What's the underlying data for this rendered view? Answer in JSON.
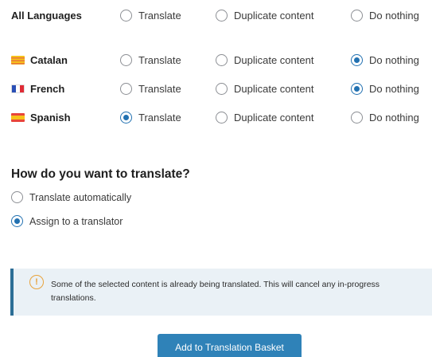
{
  "languages": [
    {
      "name": "All Languages",
      "flag": "",
      "selected": "none"
    },
    {
      "name": "Catalan",
      "flag": "catalan-flag-icon",
      "selected": "nothing"
    },
    {
      "name": "French",
      "flag": "french-flag-icon",
      "selected": "nothing"
    },
    {
      "name": "Spanish",
      "flag": "spanish-flag-icon",
      "selected": "translate"
    }
  ],
  "options": {
    "translate": "Translate",
    "duplicate": "Duplicate content",
    "nothing": "Do nothing"
  },
  "translation_mode": {
    "heading": "How do you want to translate?",
    "options": [
      {
        "label": "Translate automatically",
        "selected": false
      },
      {
        "label": "Assign to a translator",
        "selected": true
      }
    ]
  },
  "notice": {
    "text": "Some of the selected content is already being translated. This will cancel any in-progress translations.",
    "icon": "exclamation-icon"
  },
  "button": {
    "label": "Add to Translation Basket"
  },
  "colors": {
    "accent": "#2271b1",
    "button": "#2f82b8",
    "notice_bg": "#eaf1f6",
    "notice_border": "#2c6e96",
    "warning": "#e8a33c"
  }
}
